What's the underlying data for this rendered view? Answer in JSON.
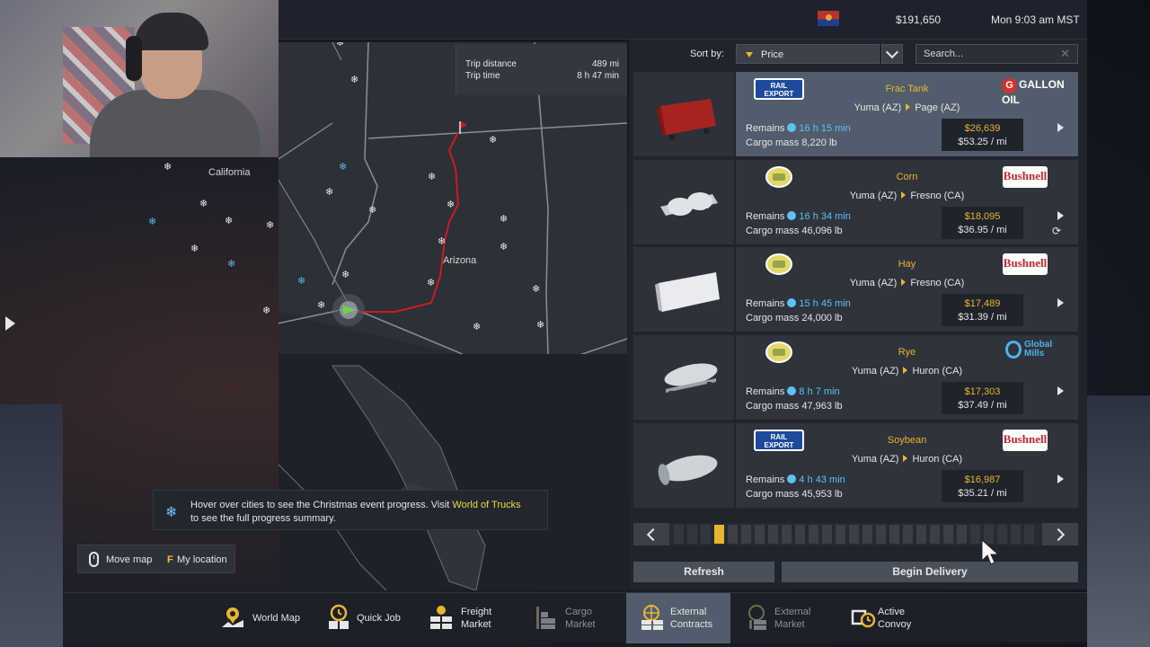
{
  "header": {
    "money": "$191,650",
    "clock": "Mon 9:03 am MST",
    "flag_icon": "arizona-flag-icon"
  },
  "trip": {
    "distance_label": "Trip distance",
    "distance_value": "489 mi",
    "time_label": "Trip time",
    "time_value": "8 h 47 min"
  },
  "map": {
    "labels": {
      "california": "California",
      "arizona": "Arizona"
    },
    "route_color": "#cc1b22",
    "marker_color": "#6fd44a"
  },
  "hint": {
    "text_before_link": "Hover over cities to see the Christmas event progress. Visit ",
    "link": "World of Trucks",
    "line2": "to see the full progress summary."
  },
  "map_controls": {
    "move_map": "Move map",
    "location_key": "F",
    "my_location": "My location"
  },
  "sort": {
    "label": "Sort by:",
    "value": "Price"
  },
  "search": {
    "placeholder": "Search..."
  },
  "jobs": [
    {
      "cargo": "Frac Tank",
      "from": "Yuma (AZ)",
      "to": "Page (AZ)",
      "remains_label": "Remains",
      "remains_time": "16 h 15 min",
      "mass_label": "Cargo mass",
      "mass": "8,220 lb",
      "price": "$26,639",
      "per_mile": "$53.25 / mi",
      "source_logo": "RAIL EXPORT",
      "dest_logo": "GALLON OIL",
      "selected": true
    },
    {
      "cargo": "Corn",
      "from": "Yuma (AZ)",
      "to": "Fresno (CA)",
      "remains_label": "Remains",
      "remains_time": "16 h 34 min",
      "mass_label": "Cargo mass",
      "mass": "46,096 lb",
      "price": "$18,095",
      "per_mile": "$36.95 / mi",
      "source_logo": "farm-logo-icon",
      "dest_logo": "Bushnell",
      "selected": false
    },
    {
      "cargo": "Hay",
      "from": "Yuma (AZ)",
      "to": "Fresno (CA)",
      "remains_label": "Remains",
      "remains_time": "15 h 45 min",
      "mass_label": "Cargo mass",
      "mass": "24,000 lb",
      "price": "$17,489",
      "per_mile": "$31.39 / mi",
      "source_logo": "farm-logo-icon",
      "dest_logo": "Bushnell",
      "selected": false
    },
    {
      "cargo": "Rye",
      "from": "Yuma (AZ)",
      "to": "Huron (CA)",
      "remains_label": "Remains",
      "remains_time": "8 h 7 min",
      "mass_label": "Cargo mass",
      "mass": "47,963 lb",
      "price": "$17,303",
      "per_mile": "$37.49 / mi",
      "source_logo": "farm-logo-icon",
      "dest_logo_line1": "Global",
      "dest_logo_line2": "Mills",
      "selected": false
    },
    {
      "cargo": "Soybean",
      "from": "Yuma (AZ)",
      "to": "Huron (CA)",
      "remains_label": "Remains",
      "remains_time": "4 h 43 min",
      "mass_label": "Cargo mass",
      "mass": "45,953 lb",
      "price": "$16,987",
      "per_mile": "$35.21 / mi",
      "source_logo": "RAIL EXPORT",
      "dest_logo": "Bushnell",
      "selected": false
    }
  ],
  "pager": {
    "total_pages": 27,
    "current_page": 4
  },
  "actions": {
    "refresh": "Refresh",
    "begin": "Begin Delivery"
  },
  "tabs": [
    {
      "line1": "World Map",
      "line2": "",
      "icon": "world-map-icon",
      "active": false,
      "disabled": false
    },
    {
      "line1": "Quick Job",
      "line2": "",
      "icon": "quick-job-icon",
      "active": false,
      "disabled": false
    },
    {
      "line1": "Freight",
      "line2": "Market",
      "icon": "freight-market-icon",
      "active": false,
      "disabled": false
    },
    {
      "line1": "Cargo",
      "line2": "Market",
      "icon": "cargo-market-icon",
      "active": false,
      "disabled": true
    },
    {
      "line1": "External",
      "line2": "Contracts",
      "icon": "external-contracts-icon",
      "active": true,
      "disabled": false
    },
    {
      "line1": "External",
      "line2": "Market",
      "icon": "external-market-icon",
      "active": false,
      "disabled": true
    },
    {
      "line1": "Active",
      "line2": "Convoy",
      "icon": "active-convoy-icon",
      "active": false,
      "disabled": false
    }
  ],
  "colors": {
    "accent": "#e9b531",
    "time_blue": "#5fc0f5",
    "selected_row": "#515d6c",
    "panel_bg": "#20242c",
    "link_yellow": "#e7e03b"
  }
}
